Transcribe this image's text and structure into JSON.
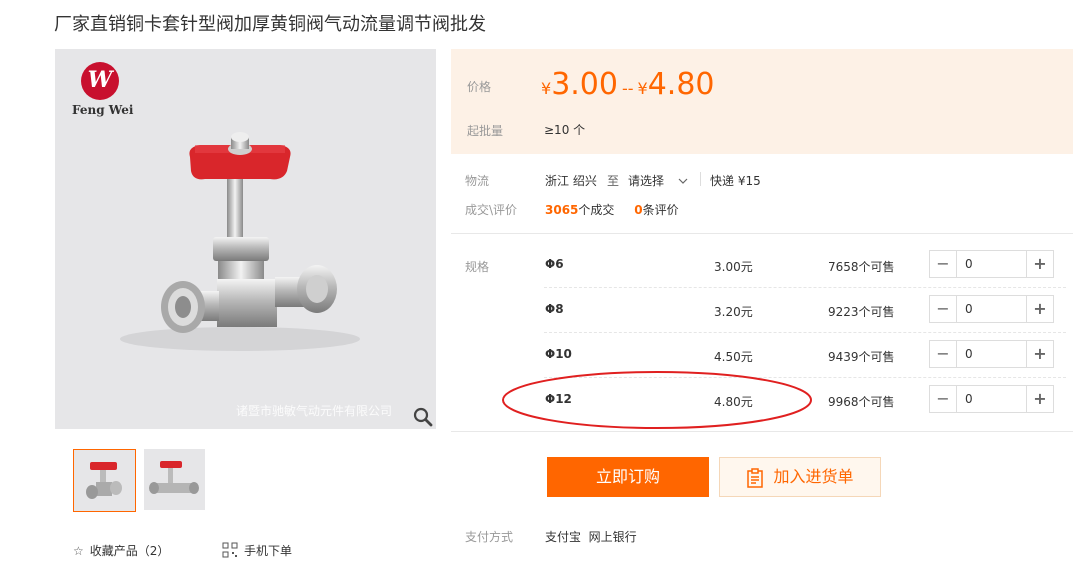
{
  "title": "厂家直销铜卡套针型阀加厚黄铜阀气动流量调节阀批发",
  "image": {
    "logo_mark": "W",
    "logo_text": "Feng Wei",
    "watermark": "诸暨市驰敏气动元件有限公司"
  },
  "price": {
    "label": "价格",
    "currency": "¥",
    "low": "3.00",
    "separator": "--",
    "high": "4.80",
    "moq_label": "起批量",
    "moq_value": "≥10 个"
  },
  "logistics": {
    "label": "物流",
    "origin": "浙江 绍兴",
    "to": "至",
    "destination": "请选择",
    "express": "快递 ¥15"
  },
  "deals": {
    "label": "成交\\评价",
    "count": "3065",
    "count_suffix": "个成交",
    "reviews": "0",
    "reviews_suffix": "条评价"
  },
  "sku": {
    "label": "规格",
    "rows": [
      {
        "name": "Φ6",
        "price": "3.00元",
        "stock": "7658个可售",
        "qty": "0"
      },
      {
        "name": "Φ8",
        "price": "3.20元",
        "stock": "9223个可售",
        "qty": "0"
      },
      {
        "name": "Φ10",
        "price": "4.50元",
        "stock": "9439个可售",
        "qty": "0"
      },
      {
        "name": "Φ12",
        "price": "4.80元",
        "stock": "9968个可售",
        "qty": "0"
      }
    ]
  },
  "buttons": {
    "order": "立即订购",
    "cart": "加入进货单"
  },
  "payment": {
    "label": "支付方式",
    "methods": "支付宝  网上银行"
  },
  "bottom": {
    "favorite": "收藏产品（2）",
    "mobile": "手机下单"
  },
  "colors": {
    "accent": "#ff6600",
    "highlight_circle": "#e02020",
    "price_bg": "#fdf1e6"
  }
}
